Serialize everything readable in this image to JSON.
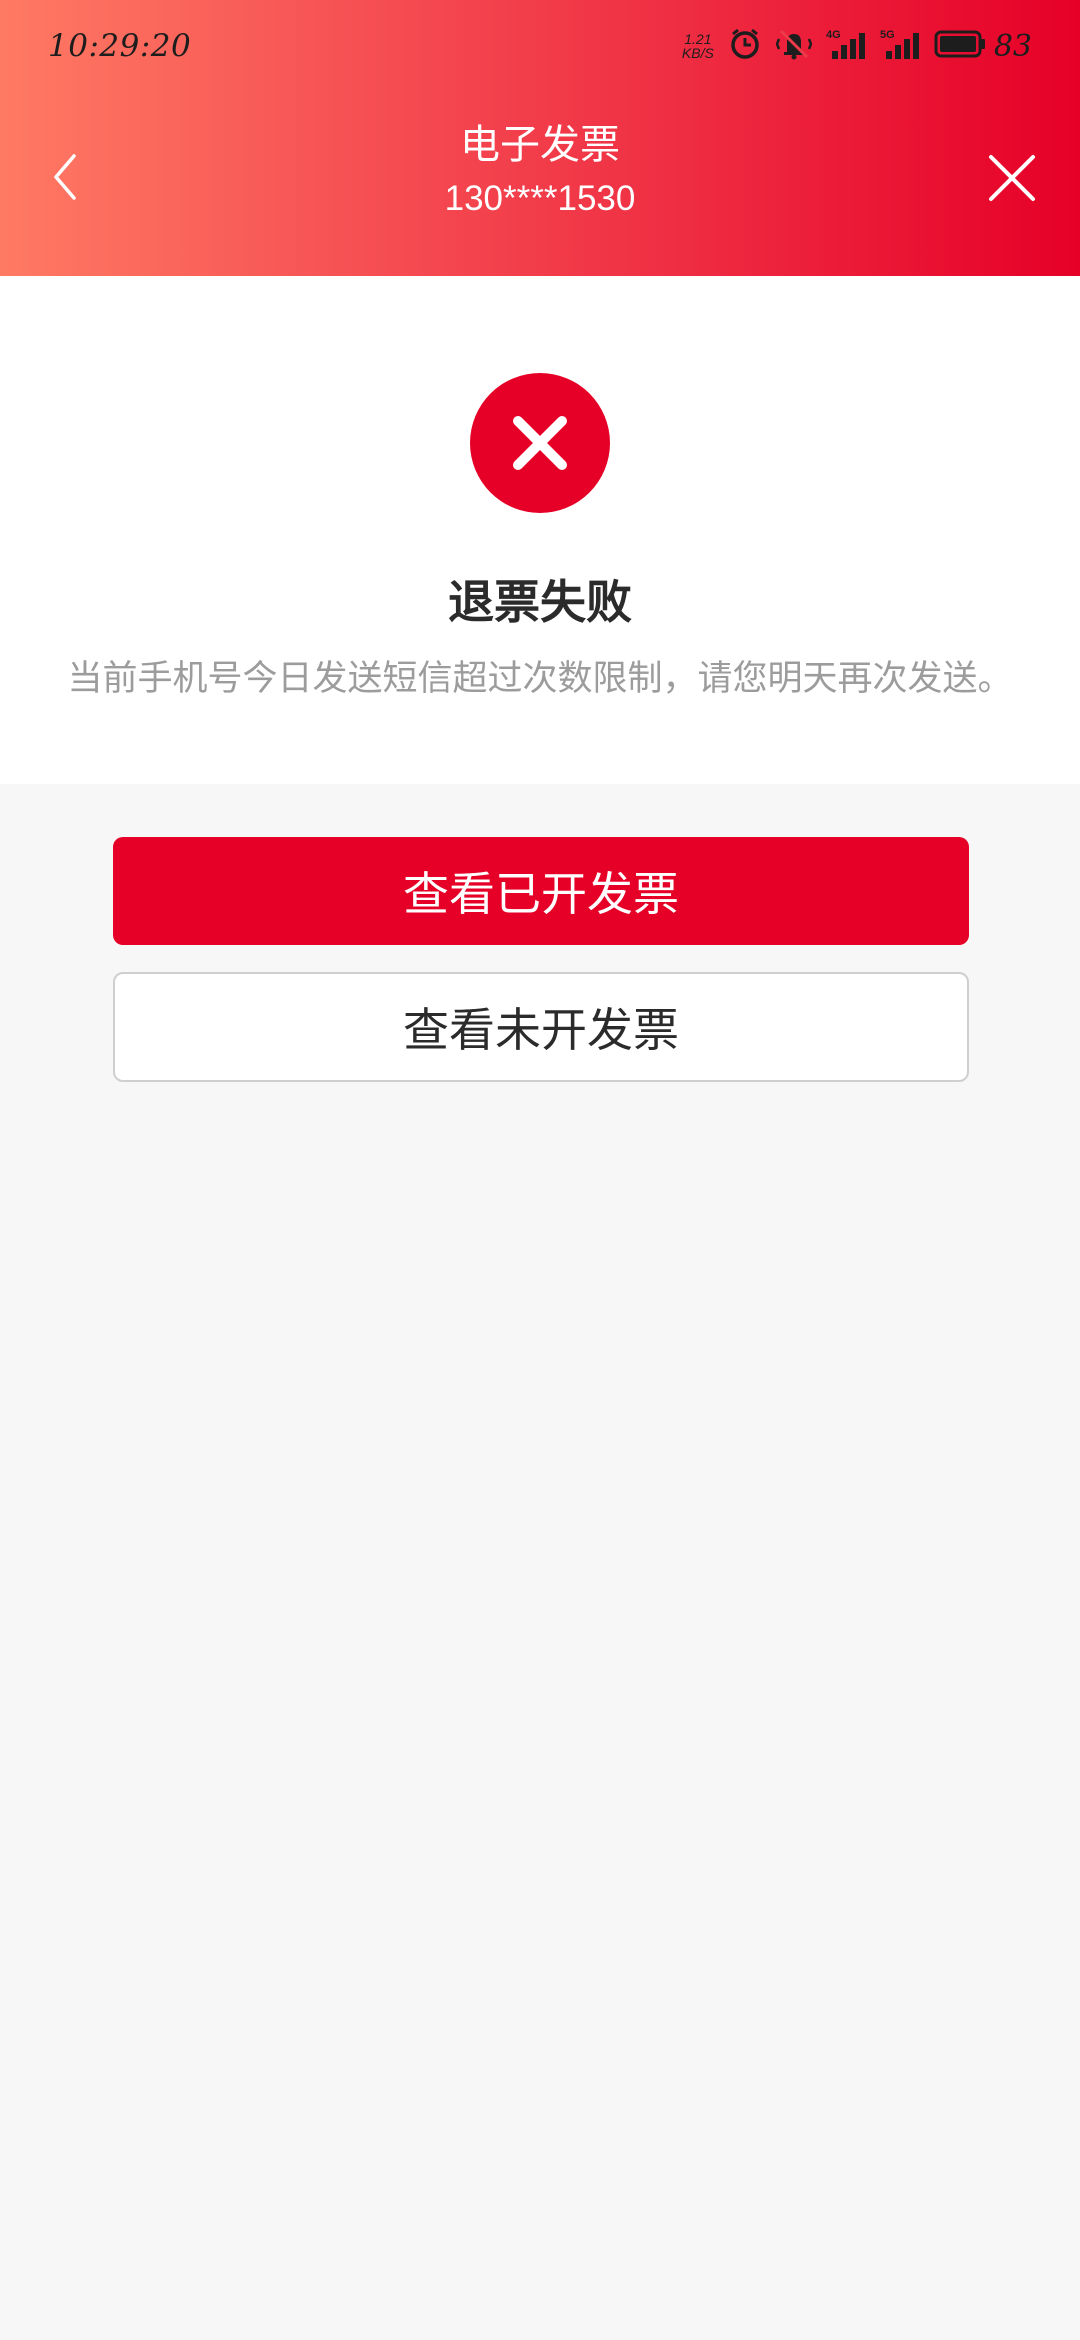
{
  "status_bar": {
    "time": "10:29:20",
    "net_speed_value": "1.21",
    "net_speed_unit": "KB/S",
    "icons": [
      "alarm-icon",
      "mute-vibrate-icon",
      "signal-4g-icon",
      "signal-5g-icon",
      "battery-icon"
    ],
    "battery_level": "83"
  },
  "header": {
    "title": "电子发票",
    "subtitle": "130****1530",
    "back_icon": "chevron-left-icon",
    "close_icon": "close-icon",
    "gradient_colors": [
      "#ff7a63",
      "#e60027"
    ]
  },
  "result": {
    "icon": "error-x-icon",
    "title": "退票失败",
    "message": "当前手机号今日发送短信超过次数限制，请您明天再次发送。",
    "icon_color": "#e60027"
  },
  "actions": {
    "primary_label": "查看已开发票",
    "secondary_label": "查看未开发票",
    "primary_color": "#e60027"
  }
}
